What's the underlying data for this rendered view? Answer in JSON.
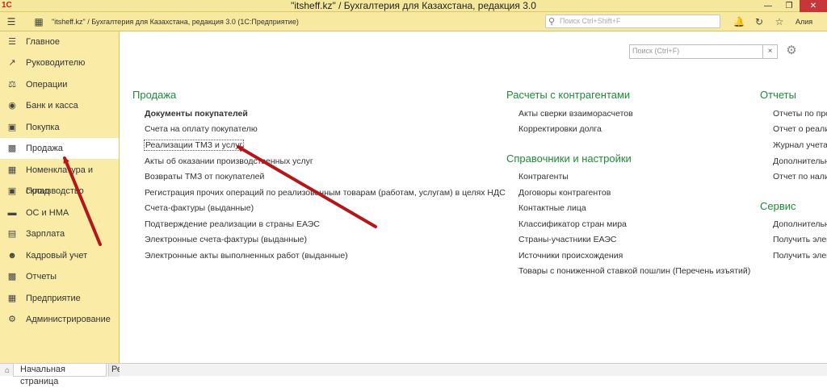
{
  "window": {
    "title": "\"itsheff.kz\" / Бухгалтерия для Казахстана, редакция 3.0",
    "logo": "1С",
    "icons": [
      "minimize-icon",
      "maximize-icon",
      "close-icon"
    ]
  },
  "toolbar": {
    "app_title": "\"itsheff.kz\" / Бухгалтерия для Казахстана, редакция 3.0  (1С:Предприятие)",
    "search_placeholder": "Поиск Ctrl+Shift+F",
    "user": "Алия"
  },
  "sidebar": {
    "items": [
      {
        "label": "Главное",
        "icon": "menu-icon"
      },
      {
        "label": "Руководителю",
        "icon": "trend-icon"
      },
      {
        "label": "Операции",
        "icon": "operations-icon"
      },
      {
        "label": "Банк и касса",
        "icon": "bank-icon"
      },
      {
        "label": "Покупка",
        "icon": "cart-icon"
      },
      {
        "label": "Продажа",
        "icon": "bag-icon"
      },
      {
        "label": "Номенклатура и склад",
        "icon": "warehouse-icon"
      },
      {
        "label": "Производство",
        "icon": "factory-icon"
      },
      {
        "label": "ОС и НМА",
        "icon": "car-icon"
      },
      {
        "label": "Зарплата",
        "icon": "money-icon"
      },
      {
        "label": "Кадровый учет",
        "icon": "people-icon"
      },
      {
        "label": "Отчеты",
        "icon": "chart-icon"
      },
      {
        "label": "Предприятие",
        "icon": "building-icon"
      },
      {
        "label": "Администрирование",
        "icon": "gear-icon"
      }
    ],
    "active": "Продажа"
  },
  "tabs": {
    "home": "Начальная страница",
    "second": "Ре"
  },
  "content": {
    "search_placeholder": "Поиск (Ctrl+F)",
    "clear": "×",
    "sales": {
      "title": "Продажа",
      "items": [
        "Документы покупателей",
        "Счета на оплату покупателю",
        "Реализации ТМЗ и услуг",
        "Акты об оказании производственных услуг",
        "Возвраты ТМЗ от покупателей",
        "Регистрация прочих операций по реализованным товарам (работам, услугам) в целях НДС",
        "Счета-фактуры (выданные)",
        "Подтверждение реализации в страны ЕАЭС",
        "Электронные счета-фактуры (выданные)",
        "Электронные акты выполненных работ (выданные)"
      ]
    },
    "settlements": {
      "title": "Расчеты с контрагентами",
      "items": [
        "Акты сверки взаиморасчетов",
        "Корректировки долга"
      ]
    },
    "references": {
      "title": "Справочники и настройки",
      "items": [
        "Контрагенты",
        "Договоры контрагентов",
        "Контактные лица",
        "Классификатор стран мира",
        "Страны-участники ЕАЭС",
        "Источники происхождения",
        "Товары с пониженной ставкой пошлин (Перечень изъятий)"
      ]
    },
    "reports": {
      "title": "Отчеты",
      "items": [
        "Отчеты по прод",
        "Отчет о реализ",
        "Журнал учета",
        "Дополнительн",
        "Отчет по нали"
      ]
    },
    "service": {
      "title": "Сервис",
      "items": [
        "Дополнительн",
        "Получить элект",
        "Получить элект"
      ]
    }
  },
  "annotation_color": "#b3171a"
}
